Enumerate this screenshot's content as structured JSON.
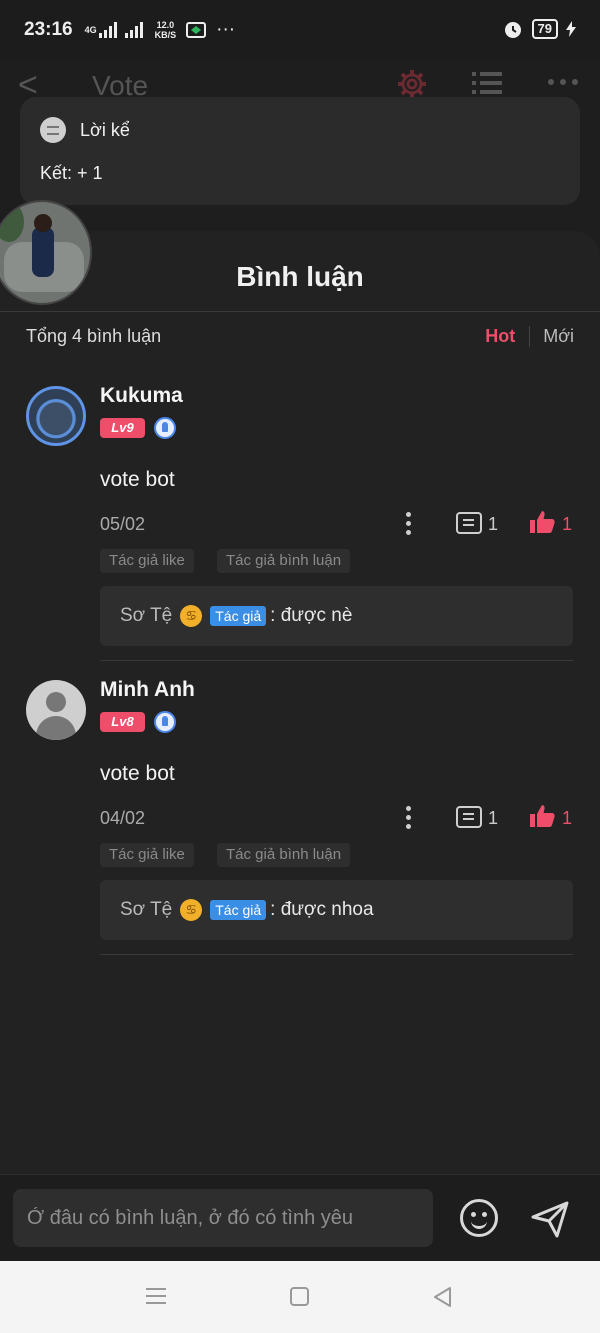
{
  "status_bar": {
    "time": "23:16",
    "network_label": "4G",
    "speed_value": "12.0",
    "speed_unit": "KB/S",
    "more": "···",
    "battery": "79"
  },
  "top_bar": {
    "back_glyph": "<",
    "title": "Vote",
    "icons": [
      "settings-icon",
      "list-icon",
      "more-icon"
    ]
  },
  "story_card": {
    "title": "Lời kể",
    "text": "Kết: + 1"
  },
  "sheet": {
    "title": "Bình luận",
    "total": "Tổng 4 bình luận",
    "sort_hot": "Hot",
    "sort_new": "Mới"
  },
  "comments": [
    {
      "author": "Kukuma",
      "level": "Lv9",
      "content": "vote bot",
      "date": "05/02",
      "reply_count": "1",
      "like_count": "1",
      "tags": [
        "Tác giả like",
        "Tác giả bình luận"
      ],
      "reply": {
        "author": "Sơ Tệ",
        "zodiac": "♋",
        "badge": "Tác giả",
        "text": ": được nè"
      }
    },
    {
      "author": "Minh Anh",
      "level": "Lv8",
      "content": "vote bot",
      "date": "04/02",
      "reply_count": "1",
      "like_count": "1",
      "tags": [
        "Tác giả like",
        "Tác giả bình luận"
      ],
      "reply": {
        "author": "Sơ Tệ",
        "zodiac": "♋",
        "badge": "Tác giả",
        "text": ": được nhoa"
      }
    }
  ],
  "input": {
    "placeholder": "Ở đâu có bình luận, ở đó có tình yêu"
  },
  "colors": {
    "accent": "#ef4e6a",
    "background": "#222222",
    "badge_blue": "#3a8ee6"
  }
}
